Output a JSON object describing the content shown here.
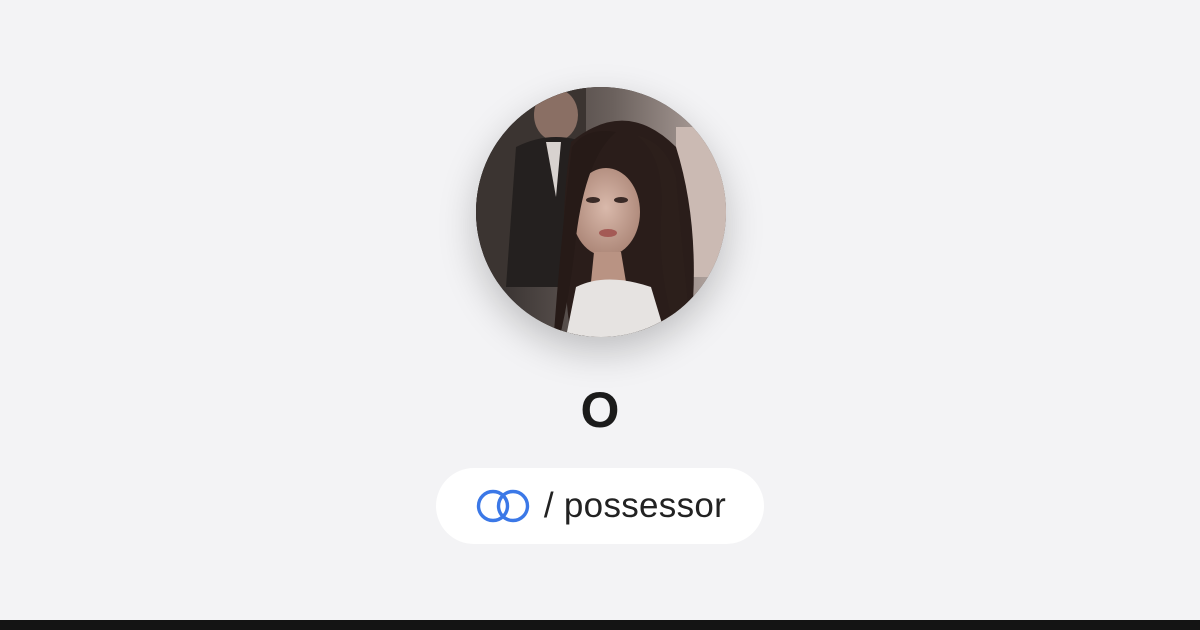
{
  "profile": {
    "display_name": "O",
    "handle": "/ possessor"
  },
  "icons": {
    "brand": "linked-rings-icon"
  },
  "colors": {
    "background": "#f3f3f5",
    "accent": "#3b78e7",
    "pill": "#ffffff",
    "text": "#1b1b1b",
    "bottom_bar": "#141414"
  }
}
